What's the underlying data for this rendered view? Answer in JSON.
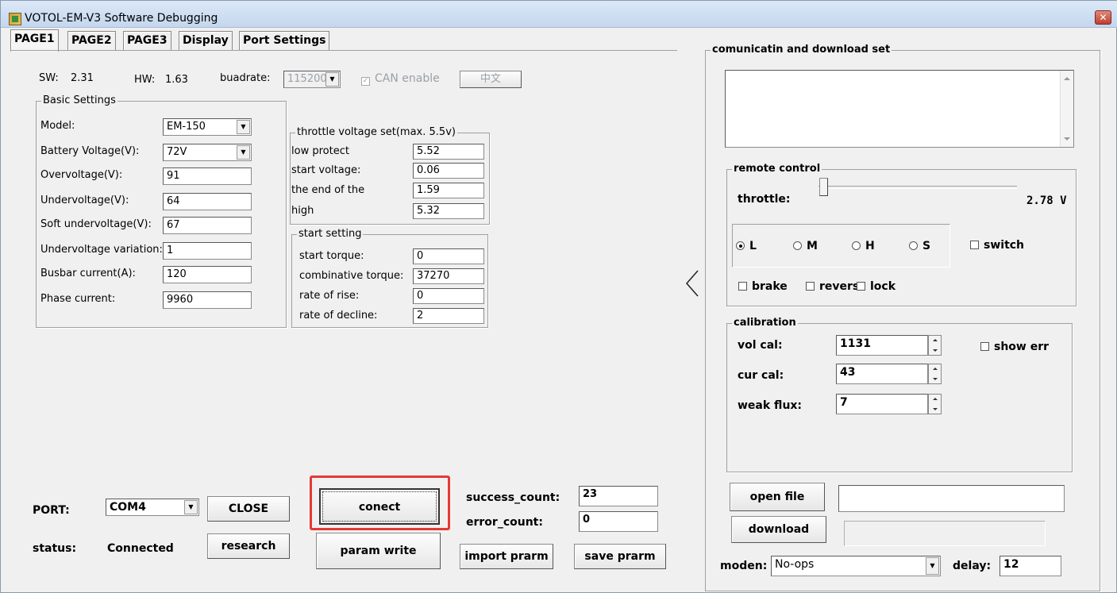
{
  "window": {
    "title": "VOTOL-EM-V3 Software Debugging",
    "close_label": "✕"
  },
  "tabs": [
    {
      "label": "PAGE1",
      "active": true
    },
    {
      "label": "PAGE2",
      "active": false
    },
    {
      "label": "PAGE3",
      "active": false
    },
    {
      "label": "Display",
      "active": false
    },
    {
      "label": "Port Settings",
      "active": false
    }
  ],
  "info": {
    "sw_label": "SW:",
    "sw_value": "2.31",
    "hw_label": "HW:",
    "hw_value": "1.63",
    "baud_label": "buadrate:",
    "baud_value": "115200",
    "can_label": "CAN enable",
    "lang_button": "中文"
  },
  "basic": {
    "title": "Basic Settings",
    "rows": [
      {
        "label": "Model:",
        "value": "EM-150",
        "combo": true
      },
      {
        "label": "Battery Voltage(V):",
        "value": "72V",
        "combo": true
      },
      {
        "label": "Overvoltage(V):",
        "value": "91"
      },
      {
        "label": "Undervoltage(V):",
        "value": "64"
      },
      {
        "label": "Soft undervoltage(V):",
        "value": "67"
      },
      {
        "label": "Undervoltage variation:",
        "value": "1"
      },
      {
        "label": "Busbar current(A):",
        "value": "120"
      },
      {
        "label": "Phase current:",
        "value": "9960"
      }
    ]
  },
  "throttle": {
    "title": "throttle voltage set(max. 5.5v)",
    "rows": [
      {
        "label": "low protect",
        "value": "5.52"
      },
      {
        "label": "start voltage:",
        "value": "0.06"
      },
      {
        "label": "the end of the",
        "value": "1.59"
      },
      {
        "label": "high",
        "value": "5.32"
      }
    ]
  },
  "start": {
    "title": "start setting",
    "rows": [
      {
        "label": "start torque:",
        "value": "0"
      },
      {
        "label": "combinative torque:",
        "value": "37270"
      },
      {
        "label": "rate of rise:",
        "value": "0"
      },
      {
        "label": "rate of decline:",
        "value": "2"
      }
    ]
  },
  "port": {
    "port_label": "PORT:",
    "port_value": "COM4",
    "close_button": "CLOSE",
    "status_label": "status:",
    "status_value": "Connected",
    "research_button": "research",
    "connect_button": "conect",
    "param_write_button": "param write",
    "success_label": "success_count:",
    "success_value": "23",
    "error_label": "error_count:",
    "error_value": "0",
    "import_button": "import prarm",
    "save_button": "save prarm"
  },
  "collapse_icon": "chevron-left-icon",
  "comm": {
    "title": "comunicatin and download set",
    "remote": {
      "title": "remote control",
      "throttle_label": "throttle:",
      "throttle_value": "2.78 V",
      "slider_fraction": 0.0,
      "modes": [
        {
          "label": "L",
          "checked": true
        },
        {
          "label": "M",
          "checked": false
        },
        {
          "label": "H",
          "checked": false
        },
        {
          "label": "S",
          "checked": false
        }
      ],
      "switch_label": "switch",
      "brake_label": "brake",
      "reverse_label": "reverse",
      "lock_label": "lock"
    },
    "calibration": {
      "title": "calibration",
      "vol_label": "vol cal:",
      "vol_value": "1131",
      "cur_label": "cur cal:",
      "cur_value": "43",
      "flux_label": "weak flux:",
      "flux_value": "7",
      "show_err_label": "show err"
    },
    "open_file_button": "open file",
    "download_button": "download",
    "moden_label": "moden:",
    "moden_value": "No-ops",
    "delay_label": "delay:",
    "delay_value": "12"
  },
  "highlight_color": "#e53935"
}
